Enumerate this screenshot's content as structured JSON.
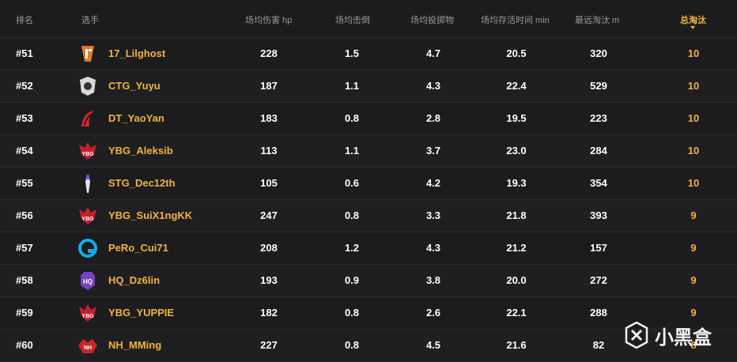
{
  "headers": {
    "rank": "排名",
    "player": "选手",
    "damage": "场均伤害 hp",
    "kills_avg": "场均击倒",
    "throwables": "场均投掷物",
    "survival": "场均存活时间 min",
    "longest": "最远淘汰 m",
    "total_kills": "总淘汰"
  },
  "rows": [
    {
      "rank": "#51",
      "player": "17_Lilghost",
      "logo": "team-17-logo",
      "damage": "228",
      "knocks": "1.5",
      "throws": "4.7",
      "survival": "20.5",
      "longest": "320",
      "kills": "10"
    },
    {
      "rank": "#52",
      "player": "CTG_Yuyu",
      "logo": "ctg-logo",
      "damage": "187",
      "knocks": "1.1",
      "throws": "4.3",
      "survival": "22.4",
      "longest": "529",
      "kills": "10"
    },
    {
      "rank": "#53",
      "player": "DT_YaoYan",
      "logo": "dt-logo",
      "damage": "183",
      "knocks": "0.8",
      "throws": "2.8",
      "survival": "19.5",
      "longest": "223",
      "kills": "10"
    },
    {
      "rank": "#54",
      "player": "YBG_Aleksib",
      "logo": "ybg-logo",
      "damage": "113",
      "knocks": "1.1",
      "throws": "3.7",
      "survival": "23.0",
      "longest": "284",
      "kills": "10"
    },
    {
      "rank": "#55",
      "player": "STG_Dec12th",
      "logo": "stg-logo",
      "damage": "105",
      "knocks": "0.6",
      "throws": "4.2",
      "survival": "19.3",
      "longest": "354",
      "kills": "10"
    },
    {
      "rank": "#56",
      "player": "YBG_SuiX1ngKK",
      "logo": "ybg-logo",
      "damage": "247",
      "knocks": "0.8",
      "throws": "3.3",
      "survival": "21.8",
      "longest": "393",
      "kills": "9"
    },
    {
      "rank": "#57",
      "player": "PeRo_Cui71",
      "logo": "pero-logo",
      "damage": "208",
      "knocks": "1.2",
      "throws": "4.3",
      "survival": "21.2",
      "longest": "157",
      "kills": "9"
    },
    {
      "rank": "#58",
      "player": "HQ_Dz6lin",
      "logo": "hq-logo",
      "damage": "193",
      "knocks": "0.9",
      "throws": "3.8",
      "survival": "20.0",
      "longest": "272",
      "kills": "9"
    },
    {
      "rank": "#59",
      "player": "YBG_YUPPIE",
      "logo": "ybg-logo",
      "damage": "182",
      "knocks": "0.8",
      "throws": "2.6",
      "survival": "22.1",
      "longest": "288",
      "kills": "9"
    },
    {
      "rank": "#60",
      "player": "NH_MMing",
      "logo": "nh-logo",
      "damage": "227",
      "knocks": "0.8",
      "throws": "4.5",
      "survival": "21.6",
      "longest": "82",
      "kills": "8"
    }
  ],
  "watermark": {
    "text": "小黑盒",
    "icon": "heybox-icon"
  },
  "colors": {
    "accent": "#f2b33d",
    "background": "#1b1b1d"
  }
}
